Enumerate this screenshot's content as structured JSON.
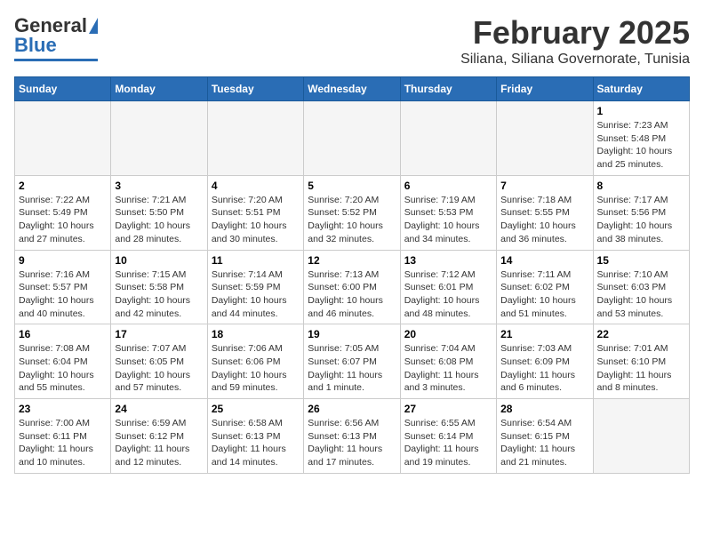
{
  "logo": {
    "general": "General",
    "blue": "Blue"
  },
  "header": {
    "month": "February 2025",
    "location": "Siliana, Siliana Governorate, Tunisia"
  },
  "days_of_week": [
    "Sunday",
    "Monday",
    "Tuesday",
    "Wednesday",
    "Thursday",
    "Friday",
    "Saturday"
  ],
  "weeks": [
    [
      {
        "day": "",
        "empty": true
      },
      {
        "day": "",
        "empty": true
      },
      {
        "day": "",
        "empty": true
      },
      {
        "day": "",
        "empty": true
      },
      {
        "day": "",
        "empty": true
      },
      {
        "day": "",
        "empty": true
      },
      {
        "day": "1",
        "sunrise": "7:23 AM",
        "sunset": "5:48 PM",
        "daylight": "10 hours and 25 minutes."
      }
    ],
    [
      {
        "day": "2",
        "sunrise": "7:22 AM",
        "sunset": "5:49 PM",
        "daylight": "10 hours and 27 minutes."
      },
      {
        "day": "3",
        "sunrise": "7:21 AM",
        "sunset": "5:50 PM",
        "daylight": "10 hours and 28 minutes."
      },
      {
        "day": "4",
        "sunrise": "7:20 AM",
        "sunset": "5:51 PM",
        "daylight": "10 hours and 30 minutes."
      },
      {
        "day": "5",
        "sunrise": "7:20 AM",
        "sunset": "5:52 PM",
        "daylight": "10 hours and 32 minutes."
      },
      {
        "day": "6",
        "sunrise": "7:19 AM",
        "sunset": "5:53 PM",
        "daylight": "10 hours and 34 minutes."
      },
      {
        "day": "7",
        "sunrise": "7:18 AM",
        "sunset": "5:55 PM",
        "daylight": "10 hours and 36 minutes."
      },
      {
        "day": "8",
        "sunrise": "7:17 AM",
        "sunset": "5:56 PM",
        "daylight": "10 hours and 38 minutes."
      }
    ],
    [
      {
        "day": "9",
        "sunrise": "7:16 AM",
        "sunset": "5:57 PM",
        "daylight": "10 hours and 40 minutes."
      },
      {
        "day": "10",
        "sunrise": "7:15 AM",
        "sunset": "5:58 PM",
        "daylight": "10 hours and 42 minutes."
      },
      {
        "day": "11",
        "sunrise": "7:14 AM",
        "sunset": "5:59 PM",
        "daylight": "10 hours and 44 minutes."
      },
      {
        "day": "12",
        "sunrise": "7:13 AM",
        "sunset": "6:00 PM",
        "daylight": "10 hours and 46 minutes."
      },
      {
        "day": "13",
        "sunrise": "7:12 AM",
        "sunset": "6:01 PM",
        "daylight": "10 hours and 48 minutes."
      },
      {
        "day": "14",
        "sunrise": "7:11 AM",
        "sunset": "6:02 PM",
        "daylight": "10 hours and 51 minutes."
      },
      {
        "day": "15",
        "sunrise": "7:10 AM",
        "sunset": "6:03 PM",
        "daylight": "10 hours and 53 minutes."
      }
    ],
    [
      {
        "day": "16",
        "sunrise": "7:08 AM",
        "sunset": "6:04 PM",
        "daylight": "10 hours and 55 minutes."
      },
      {
        "day": "17",
        "sunrise": "7:07 AM",
        "sunset": "6:05 PM",
        "daylight": "10 hours and 57 minutes."
      },
      {
        "day": "18",
        "sunrise": "7:06 AM",
        "sunset": "6:06 PM",
        "daylight": "10 hours and 59 minutes."
      },
      {
        "day": "19",
        "sunrise": "7:05 AM",
        "sunset": "6:07 PM",
        "daylight": "11 hours and 1 minute."
      },
      {
        "day": "20",
        "sunrise": "7:04 AM",
        "sunset": "6:08 PM",
        "daylight": "11 hours and 3 minutes."
      },
      {
        "day": "21",
        "sunrise": "7:03 AM",
        "sunset": "6:09 PM",
        "daylight": "11 hours and 6 minutes."
      },
      {
        "day": "22",
        "sunrise": "7:01 AM",
        "sunset": "6:10 PM",
        "daylight": "11 hours and 8 minutes."
      }
    ],
    [
      {
        "day": "23",
        "sunrise": "7:00 AM",
        "sunset": "6:11 PM",
        "daylight": "11 hours and 10 minutes."
      },
      {
        "day": "24",
        "sunrise": "6:59 AM",
        "sunset": "6:12 PM",
        "daylight": "11 hours and 12 minutes."
      },
      {
        "day": "25",
        "sunrise": "6:58 AM",
        "sunset": "6:13 PM",
        "daylight": "11 hours and 14 minutes."
      },
      {
        "day": "26",
        "sunrise": "6:56 AM",
        "sunset": "6:13 PM",
        "daylight": "11 hours and 17 minutes."
      },
      {
        "day": "27",
        "sunrise": "6:55 AM",
        "sunset": "6:14 PM",
        "daylight": "11 hours and 19 minutes."
      },
      {
        "day": "28",
        "sunrise": "6:54 AM",
        "sunset": "6:15 PM",
        "daylight": "11 hours and 21 minutes."
      },
      {
        "day": "",
        "empty": true
      }
    ]
  ]
}
